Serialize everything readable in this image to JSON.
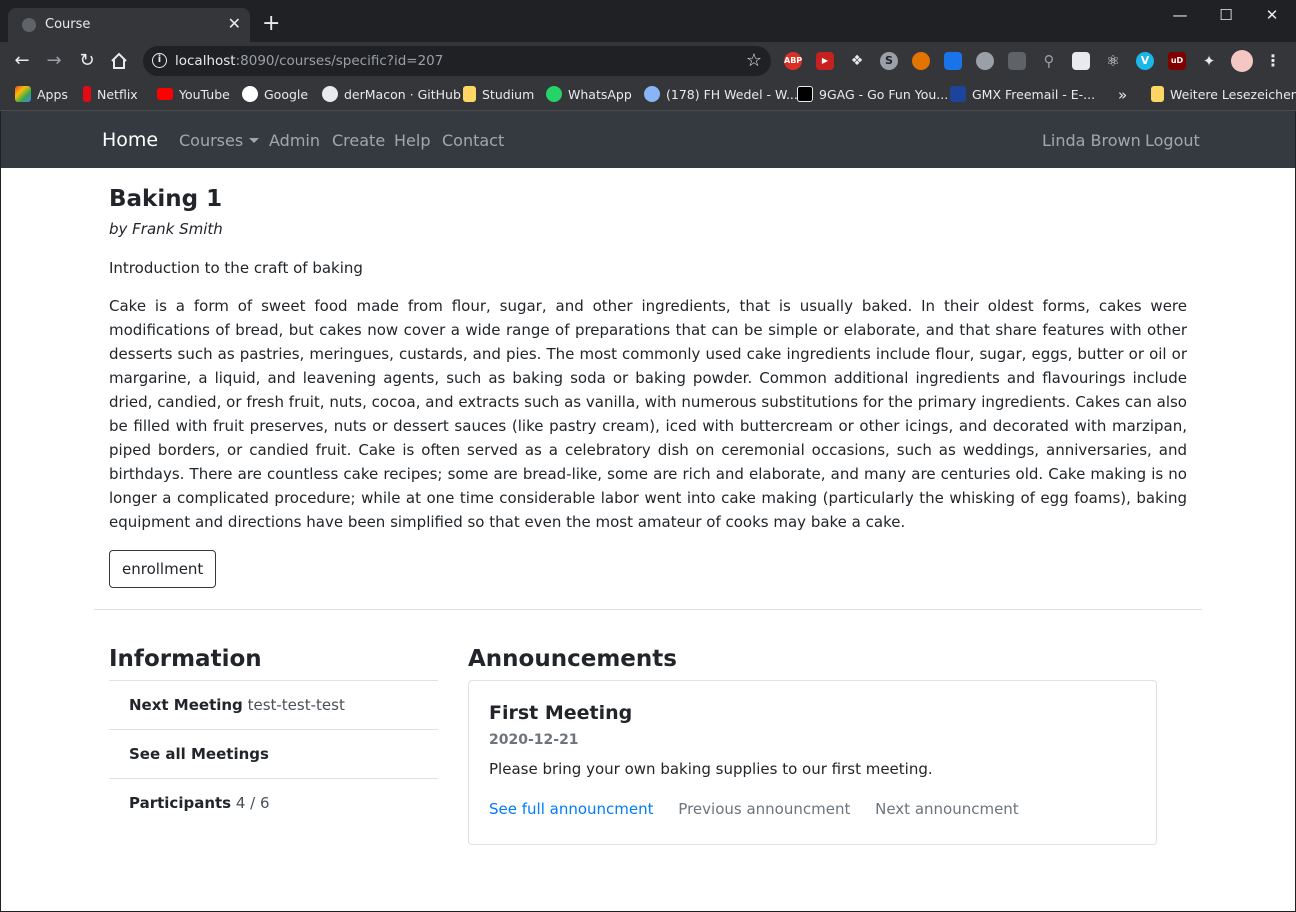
{
  "browser": {
    "tab_title": "Course",
    "new_tab": "+",
    "close_tab": "✕",
    "url_host": "localhost",
    "url_path": ":8090/courses/specific?id=207",
    "window_controls": {
      "minimize": "—",
      "maximize": "☐",
      "close": "✕"
    },
    "extensions": [
      "ABP",
      "readability",
      "dropbox",
      "skype",
      "tamper",
      "chart",
      "discord",
      "data",
      "search",
      "ai",
      "react",
      "vimeo",
      "uBlock",
      "puzzle",
      "profile"
    ],
    "bookmarks": {
      "apps": "Apps",
      "netflix": "Netflix",
      "youtube": "YouTube",
      "google": "Google",
      "github": "derMacon · GitHub",
      "studium": "Studium",
      "whatsapp": "WhatsApp",
      "fhwedel": "(178) FH Wedel - W...",
      "ninegag": "9GAG - Go Fun You...",
      "gmx": "GMX Freemail - E-...",
      "overflow": "»",
      "more": "Weitere Lesezeichen"
    }
  },
  "nav": {
    "brand": "Home",
    "courses": "Courses",
    "admin": "Admin",
    "create": "Create",
    "help": "Help",
    "contact": "Contact",
    "user": "Linda Brown",
    "logout": "Logout"
  },
  "course": {
    "title": "Baking 1",
    "author": "by Frank Smith",
    "intro": "Introduction to the craft of baking",
    "description": "Cake is a form of sweet food made from flour, sugar, and other ingredients, that is usually baked. In their oldest forms, cakes were modifications of bread, but cakes now cover a wide range of preparations that can be simple or elaborate, and that share features with other desserts such as pastries, meringues, custards, and pies. The most commonly used cake ingredients include flour, sugar, eggs, butter or oil or margarine, a liquid, and leavening agents, such as baking soda or baking powder. Common additional ingredients and flavourings include dried, candied, or fresh fruit, nuts, cocoa, and extracts such as vanilla, with numerous substitutions for the primary ingredients. Cakes can also be filled with fruit preserves, nuts or dessert sauces (like pastry cream), iced with buttercream or other icings, and decorated with marzipan, piped borders, or candied fruit. Cake is often served as a celebratory dish on ceremonial occasions, such as weddings, anniversaries, and birthdays. There are countless cake recipes; some are bread-like, some are rich and elaborate, and many are centuries old. Cake making is no longer a complicated procedure; while at one time considerable labor went into cake making (particularly the whisking of egg foams), baking equipment and directions have been simplified so that even the most amateur of cooks may bake a cake.",
    "enroll_label": "enrollment"
  },
  "information": {
    "heading": "Information",
    "next_meeting_label": "Next Meeting",
    "next_meeting_value": "test-test-test",
    "all_meetings_label": "See all Meetings",
    "participants_label": "Participants",
    "participants_value": "4 / 6"
  },
  "announcements": {
    "heading": "Announcements",
    "title": "First Meeting",
    "date": "2020-12-21",
    "text": "Please bring your own baking supplies to our first meeting.",
    "full_link": "See full announcment",
    "prev_link": "Previous announcment",
    "next_link": "Next announcment"
  },
  "colors": {
    "navbar": "#343a40",
    "primary": "#007bff",
    "muted": "#6c757d",
    "chrome_dark": "#202124",
    "chrome_toolbar": "#35363a"
  }
}
